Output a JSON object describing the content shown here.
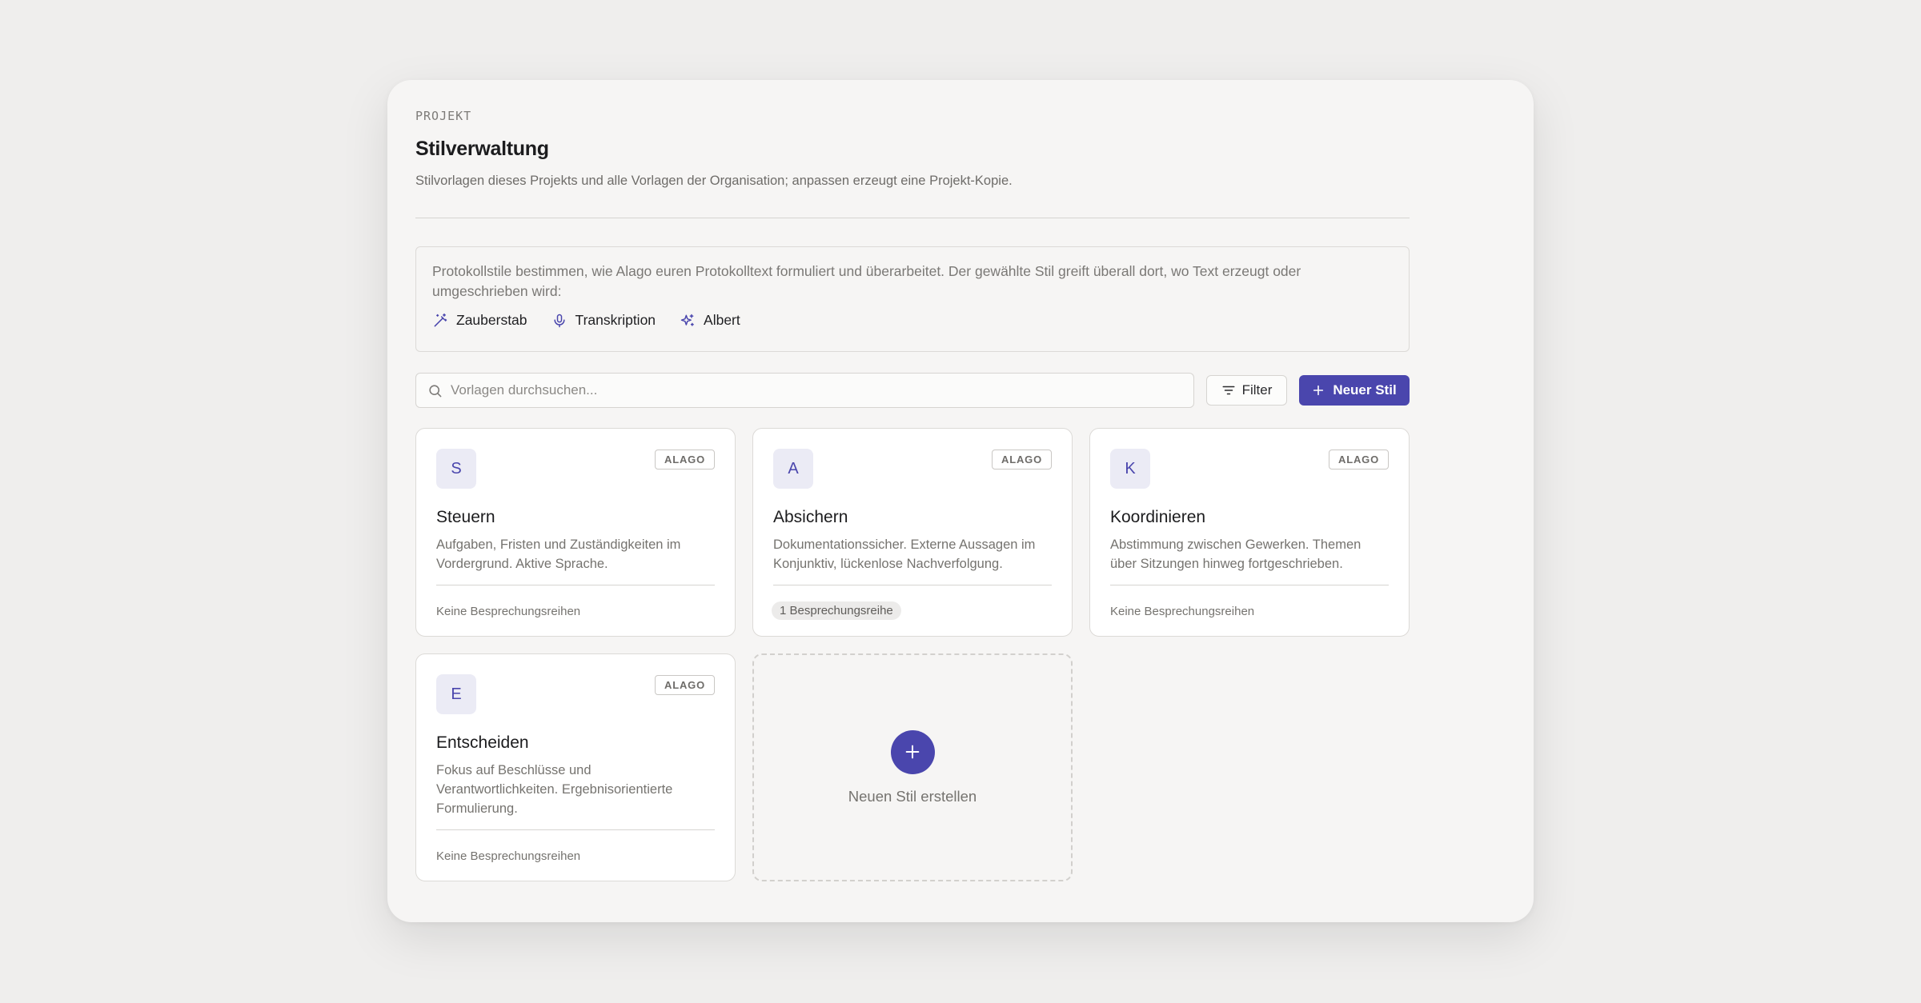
{
  "header": {
    "eyebrow": "PROJEKT",
    "title": "Stilverwaltung",
    "subtitle": "Stilvorlagen dieses Projekts und alle Vorlagen der Organisation; anpassen erzeugt eine Projekt-Kopie."
  },
  "info": {
    "text": "Protokollstile bestimmen, wie Alago euren Protokolltext formuliert und überarbeitet. Der gewählte Stil greift überall dort, wo Text erzeugt oder umgeschrieben wird:",
    "features": [
      {
        "label": "Zauberstab",
        "icon": "magic-wand-icon"
      },
      {
        "label": "Transkription",
        "icon": "microphone-icon"
      },
      {
        "label": "Albert",
        "icon": "sparkles-icon"
      }
    ]
  },
  "toolbar": {
    "search_placeholder": "Vorlagen durchsuchen...",
    "filter_label": "Filter",
    "new_label": "Neuer Stil"
  },
  "styles": [
    {
      "initial": "S",
      "badge": "ALAGO",
      "title": "Steuern",
      "description": "Aufgaben, Fristen und Zuständigkeiten im Vordergrund. Aktive Sprache.",
      "footer": "Keine Besprechungsreihen"
    },
    {
      "initial": "A",
      "badge": "ALAGO",
      "title": "Absichern",
      "description": "Dokumentationssicher. Externe Aussagen im Konjunktiv, lückenlose Nachverfolgung.",
      "footer": "1 Besprechungsreihe"
    },
    {
      "initial": "K",
      "badge": "ALAGO",
      "title": "Koordinieren",
      "description": "Abstimmung zwischen Gewerken. Themen über Sitzungen hinweg fortgeschrieben.",
      "footer": "Keine Besprechungsreihen"
    },
    {
      "initial": "E",
      "badge": "ALAGO",
      "title": "Entscheiden",
      "description": "Fokus auf Beschlüsse und Verantwortlichkeiten. Ergebnisorientierte Formulierung.",
      "footer": "Keine Besprechungsreihen"
    }
  ],
  "create_card": {
    "label": "Neuen Stil erstellen"
  },
  "colors": {
    "accent": "#4a46ad",
    "background": "#efeeed",
    "panel": "#f6f5f4"
  }
}
